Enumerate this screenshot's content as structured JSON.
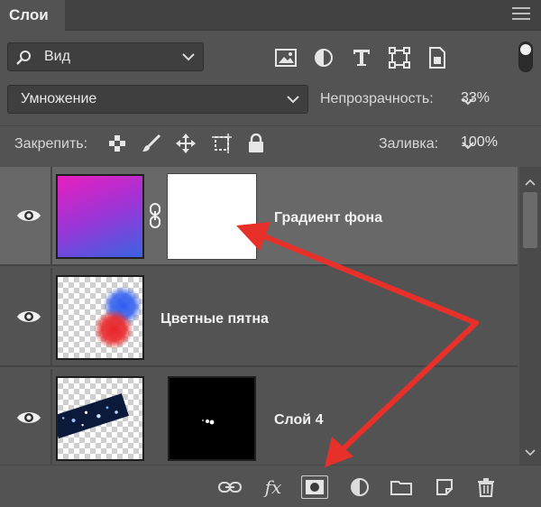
{
  "panel": {
    "tab_label": "Слои"
  },
  "filter": {
    "label": "Вид",
    "icons": [
      "image-filter-icon",
      "adjustment-filter-icon",
      "type-filter-icon",
      "shape-filter-icon",
      "smart-object-filter-icon"
    ]
  },
  "blend": {
    "mode": "Умножение",
    "opacity_label": "Непрозрачность:",
    "opacity_value": "33%"
  },
  "lock": {
    "label": "Закрепить:",
    "fill_label": "Заливка:",
    "fill_value": "100%"
  },
  "layers": [
    {
      "name": "Градиент фона",
      "visible": true,
      "selected": true,
      "has_mask": true,
      "linked": true
    },
    {
      "name": "Цветные пятна",
      "visible": true,
      "selected": false,
      "has_mask": false
    },
    {
      "name": "Слой 4",
      "visible": true,
      "selected": false,
      "has_mask": true
    }
  ],
  "bottom_toolbar": {
    "fx_label": "fx",
    "icons": [
      "link-layers-icon",
      "layer-style-icon",
      "add-mask-icon",
      "adjustment-layer-icon",
      "group-icon",
      "new-layer-icon",
      "delete-icon"
    ]
  },
  "colors": {
    "panel_bg": "#535353",
    "selected_row": "#686868",
    "annotation_arrow": "#e8302a",
    "gradient_start": "#e81fc4",
    "gradient_end": "#3f5fe0"
  }
}
